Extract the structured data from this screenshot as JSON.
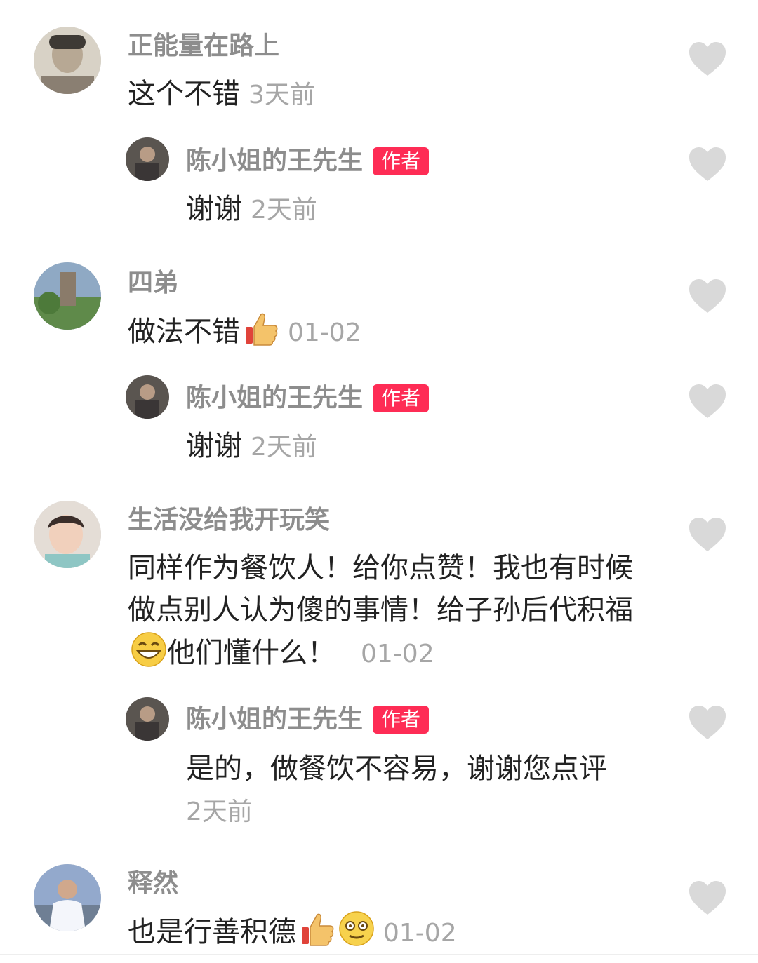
{
  "comments": [
    {
      "name": "正能量在路上",
      "text": "这个不错",
      "time": "3天前",
      "reply": {
        "name": "陈小姐的王先生",
        "badge": "作者",
        "text": "谢谢",
        "time": "2天前"
      }
    },
    {
      "name": "四弟",
      "text": "做法不错",
      "emoji": "thumbs-up",
      "time": "01-02",
      "reply": {
        "name": "陈小姐的王先生",
        "badge": "作者",
        "text": "谢谢",
        "time": "2天前"
      }
    },
    {
      "name": "生活没给我开玩笑",
      "text_part1": "同样作为餐饮人！给你点赞！我也有时候做点别人认为傻的事情！给子孙后代积福",
      "emoji": "grin",
      "text_part2": "他们懂什么！",
      "time": "01-02",
      "reply": {
        "name": "陈小姐的王先生",
        "badge": "作者",
        "text": "是的，做餐饮不容易，谢谢您点评",
        "time": "2天前"
      }
    },
    {
      "name": "释然",
      "text": "也是行善积德",
      "emojis": [
        "thumbs-up",
        "dizzy-smile"
      ],
      "time": "01-02"
    }
  ],
  "icons": {
    "like": "heart-outline-icon"
  },
  "colors": {
    "author_badge": "#fe2c55",
    "name": "#8d8d8d",
    "heart": "#d9d9d9"
  }
}
